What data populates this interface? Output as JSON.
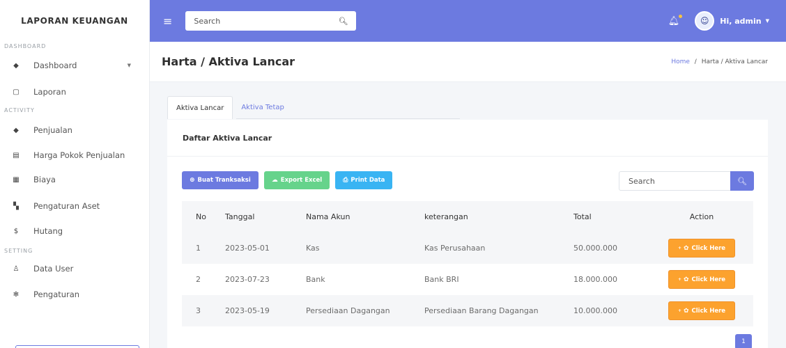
{
  "sidebar": {
    "brand": "LAPORAN KEUANGAN",
    "sections": [
      {
        "title": "DASHBOARD"
      },
      {
        "title": "ACTIVITY"
      },
      {
        "title": "SETTING"
      }
    ],
    "items": [
      {
        "label": "Dashboard",
        "icon": "dashboard-icon",
        "glyph": "◆"
      },
      {
        "label": "Laporan",
        "icon": "report-icon",
        "glyph": "▢"
      },
      {
        "label": "Penjualan",
        "icon": "tag-icon",
        "glyph": "◆"
      },
      {
        "label": "Harga Pokok Penjualan",
        "icon": "list-icon",
        "glyph": "▤"
      },
      {
        "label": "Biaya",
        "icon": "calculator-icon",
        "glyph": "▦"
      },
      {
        "label": "Pengaturan Aset",
        "icon": "building-icon",
        "glyph": "▚"
      },
      {
        "label": "Hutang",
        "icon": "dollar-icon",
        "glyph": "$"
      },
      {
        "label": "Data User",
        "icon": "user-icon",
        "glyph": "♙"
      },
      {
        "label": "Pengaturan",
        "icon": "tools-icon",
        "glyph": "✻"
      }
    ]
  },
  "topbar": {
    "search_placeholder": "Search",
    "user_greeting": "Hi, admin",
    "accent_color": "#6c7ae0"
  },
  "header": {
    "title": "Harta / Aktiva Lancar",
    "breadcrumb_home": "Home",
    "breadcrumb_separator": "/",
    "breadcrumb_current": "Harta / Aktiva Lancar"
  },
  "tabs": [
    {
      "label": "Aktiva Lancar",
      "active": true
    },
    {
      "label": "Aktiva Tetap",
      "active": false
    }
  ],
  "card": {
    "title": "Daftar Aktiva Lancar",
    "buttons": {
      "create": "Buat Tranksaksi",
      "export": "Export Excel",
      "print": "Print Data"
    },
    "search_placeholder": "Search"
  },
  "table": {
    "columns": [
      "No",
      "Tanggal",
      "Nama Akun",
      "keterangan",
      "Total",
      "Action"
    ],
    "rows": [
      {
        "no": "1",
        "tanggal": "2023-05-01",
        "akun": "Kas",
        "keterangan": "Kas Perusahaan",
        "total": "50.000.000",
        "action": "Click Here"
      },
      {
        "no": "2",
        "tanggal": "2023-07-23",
        "akun": "Bank",
        "keterangan": "Bank BRI",
        "total": "18.000.000",
        "action": "Click Here"
      },
      {
        "no": "3",
        "tanggal": "2023-05-19",
        "akun": "Persediaan Dagangan",
        "keterangan": "Persediaan Barang Dagangan",
        "total": "10.000.000",
        "action": "Click Here"
      }
    ]
  },
  "pagination": {
    "current": "1"
  }
}
